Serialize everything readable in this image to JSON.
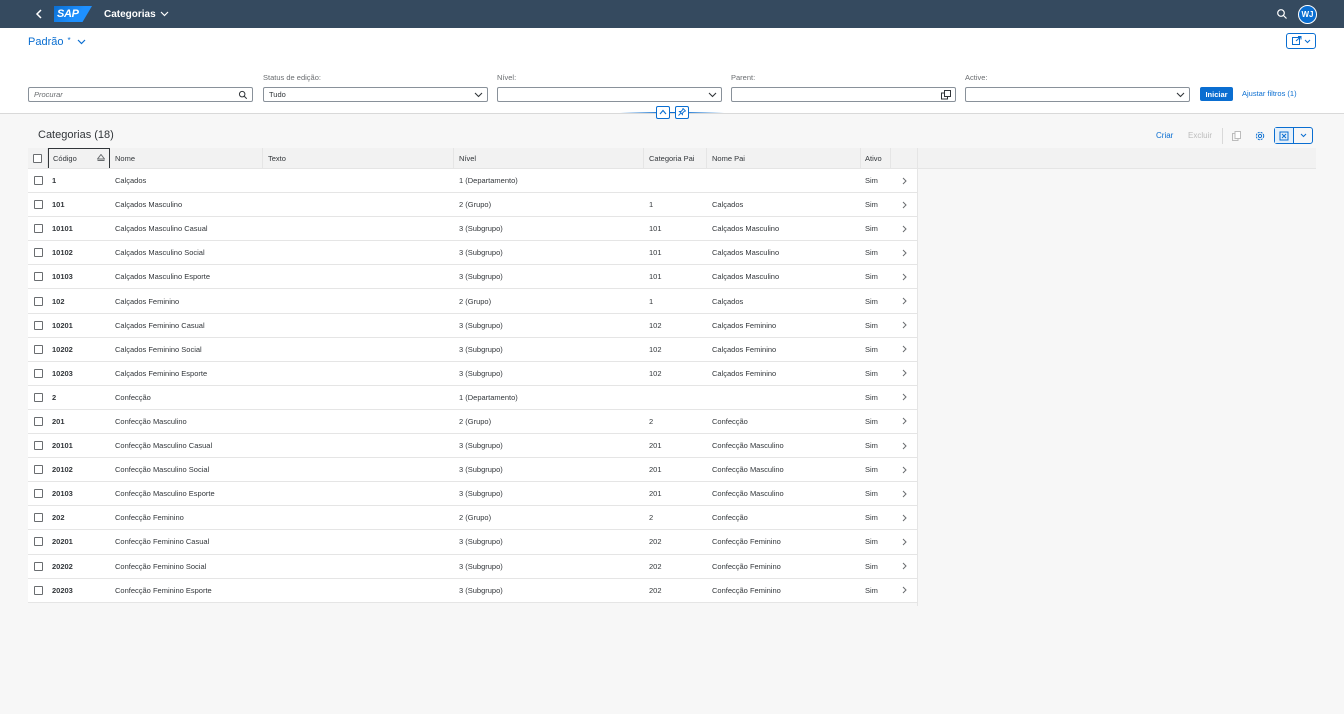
{
  "shell": {
    "title": "Categorias",
    "logo_text": "SAP",
    "avatar_initials": "WJ"
  },
  "header": {
    "variant_name": "Padrão",
    "variant_modified": "*"
  },
  "filters": {
    "search_placeholder": "Procurar",
    "status_label": "Status de edição:",
    "status_value": "Tudo",
    "nivel_label": "Nível:",
    "nivel_value": "",
    "parent_label": "Parent:",
    "parent_value": "",
    "active_label": "Active:",
    "active_value": "",
    "go_button": "Iniciar",
    "adapt_filters": "Ajustar filtros (1)"
  },
  "table": {
    "title": "Categorias (18)",
    "create_label": "Criar",
    "delete_label": "Excluir",
    "columns": [
      "Código",
      "Nome",
      "Texto",
      "Nível",
      "Categoria Pai",
      "Nome Pai",
      "Ativo"
    ],
    "rows": [
      {
        "codigo": "1",
        "nome": "Calçados",
        "texto": "",
        "nivel": "1 (Departamento)",
        "cat_pai": "",
        "nome_pai": "",
        "ativo": "Sim"
      },
      {
        "codigo": "101",
        "nome": "Calçados Masculino",
        "texto": "",
        "nivel": "2 (Grupo)",
        "cat_pai": "1",
        "nome_pai": "Calçados",
        "ativo": "Sim"
      },
      {
        "codigo": "10101",
        "nome": "Calçados Masculino Casual",
        "texto": "",
        "nivel": "3 (Subgrupo)",
        "cat_pai": "101",
        "nome_pai": "Calçados Masculino",
        "ativo": "Sim"
      },
      {
        "codigo": "10102",
        "nome": "Calçados Masculino Social",
        "texto": "",
        "nivel": "3 (Subgrupo)",
        "cat_pai": "101",
        "nome_pai": "Calçados Masculino",
        "ativo": "Sim"
      },
      {
        "codigo": "10103",
        "nome": "Calçados Masculino Esporte",
        "texto": "",
        "nivel": "3 (Subgrupo)",
        "cat_pai": "101",
        "nome_pai": "Calçados Masculino",
        "ativo": "Sim"
      },
      {
        "codigo": "102",
        "nome": "Calçados Feminino",
        "texto": "",
        "nivel": "2 (Grupo)",
        "cat_pai": "1",
        "nome_pai": "Calçados",
        "ativo": "Sim"
      },
      {
        "codigo": "10201",
        "nome": "Calçados Feminino Casual",
        "texto": "",
        "nivel": "3 (Subgrupo)",
        "cat_pai": "102",
        "nome_pai": "Calçados Feminino",
        "ativo": "Sim"
      },
      {
        "codigo": "10202",
        "nome": "Calçados Feminino Social",
        "texto": "",
        "nivel": "3 (Subgrupo)",
        "cat_pai": "102",
        "nome_pai": "Calçados Feminino",
        "ativo": "Sim"
      },
      {
        "codigo": "10203",
        "nome": "Calçados Feminino Esporte",
        "texto": "",
        "nivel": "3 (Subgrupo)",
        "cat_pai": "102",
        "nome_pai": "Calçados Feminino",
        "ativo": "Sim"
      },
      {
        "codigo": "2",
        "nome": "Confecção",
        "texto": "",
        "nivel": "1 (Departamento)",
        "cat_pai": "",
        "nome_pai": "",
        "ativo": "Sim"
      },
      {
        "codigo": "201",
        "nome": "Confecção Masculino",
        "texto": "",
        "nivel": "2 (Grupo)",
        "cat_pai": "2",
        "nome_pai": "Confecção",
        "ativo": "Sim"
      },
      {
        "codigo": "20101",
        "nome": "Confecção Masculino Casual",
        "texto": "",
        "nivel": "3 (Subgrupo)",
        "cat_pai": "201",
        "nome_pai": "Confecção Masculino",
        "ativo": "Sim"
      },
      {
        "codigo": "20102",
        "nome": "Confecção Masculino Social",
        "texto": "",
        "nivel": "3 (Subgrupo)",
        "cat_pai": "201",
        "nome_pai": "Confecção Masculino",
        "ativo": "Sim"
      },
      {
        "codigo": "20103",
        "nome": "Confecção Masculino Esporte",
        "texto": "",
        "nivel": "3 (Subgrupo)",
        "cat_pai": "201",
        "nome_pai": "Confecção Masculino",
        "ativo": "Sim"
      },
      {
        "codigo": "202",
        "nome": "Confecção Feminino",
        "texto": "",
        "nivel": "2 (Grupo)",
        "cat_pai": "2",
        "nome_pai": "Confecção",
        "ativo": "Sim"
      },
      {
        "codigo": "20201",
        "nome": "Confecção Feminino Casual",
        "texto": "",
        "nivel": "3 (Subgrupo)",
        "cat_pai": "202",
        "nome_pai": "Confecção Feminino",
        "ativo": "Sim"
      },
      {
        "codigo": "20202",
        "nome": "Confecção Feminino Social",
        "texto": "",
        "nivel": "3 (Subgrupo)",
        "cat_pai": "202",
        "nome_pai": "Confecção Feminino",
        "ativo": "Sim"
      },
      {
        "codigo": "20203",
        "nome": "Confecção Feminino Esporte",
        "texto": "",
        "nivel": "3 (Subgrupo)",
        "cat_pai": "202",
        "nome_pai": "Confecção Feminino",
        "ativo": "Sim"
      }
    ]
  },
  "colors": {
    "shell_bg": "#354a5f",
    "accent": "#0a6ed1",
    "disabled": "#bcbcbc"
  },
  "icons": [
    "back-icon",
    "chevron-down-icon",
    "search-icon",
    "share-icon",
    "value-help-icon",
    "collapse-icon",
    "pin-icon",
    "copy-icon",
    "settings-icon",
    "export-icon",
    "navigation-arrow-icon",
    "sort-ascending-icon"
  ]
}
